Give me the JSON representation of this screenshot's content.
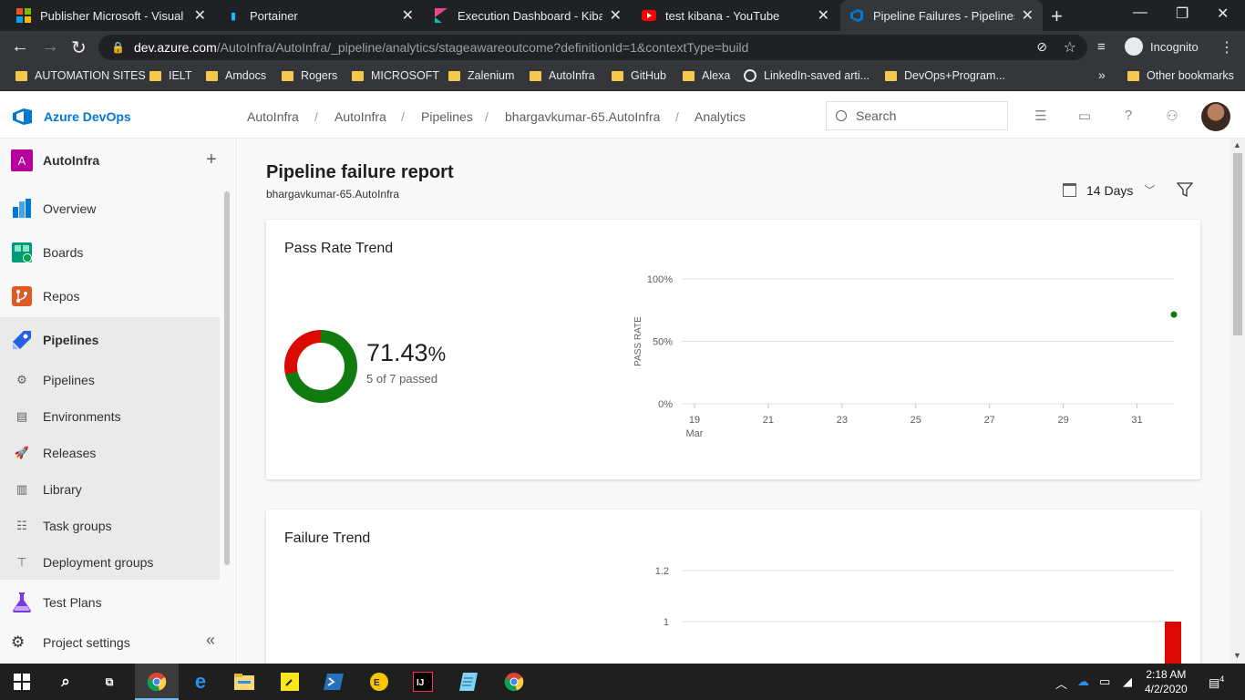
{
  "browser": {
    "tabs": [
      {
        "title": "Publisher Microsoft - Visual Stu",
        "icon": "windows-icon",
        "color": "#f25022"
      },
      {
        "title": "Portainer",
        "icon": "portainer-icon",
        "color": "#13bef9"
      },
      {
        "title": "Execution Dashboard - Kibana",
        "icon": "kibana-icon",
        "color": "#e8488b"
      },
      {
        "title": "test kibana - YouTube",
        "icon": "youtube-icon",
        "color": "#ff0000"
      },
      {
        "title": "Pipeline Failures - Pipelines",
        "icon": "azure-devops-icon",
        "color": "#0078d4",
        "active": true
      }
    ],
    "url_host": "dev.azure.com",
    "url_path": "/AutoInfra/AutoInfra/_pipeline/analytics/stageawareoutcome?definitionId=1&contextType=build",
    "incognito_label": "Incognito",
    "bookmarks": [
      {
        "label": "AUTOMATION SITES",
        "icon": "folder-icon"
      },
      {
        "label": "IELT",
        "icon": "folder-icon"
      },
      {
        "label": "Amdocs",
        "icon": "folder-icon"
      },
      {
        "label": "Rogers",
        "icon": "folder-icon"
      },
      {
        "label": "MICROSOFT",
        "icon": "folder-icon"
      },
      {
        "label": "Zalenium",
        "icon": "folder-icon"
      },
      {
        "label": "AutoInfra",
        "icon": "folder-icon"
      },
      {
        "label": "GitHub",
        "icon": "folder-icon"
      },
      {
        "label": "Alexa",
        "icon": "folder-icon"
      },
      {
        "label": "LinkedIn-saved arti...",
        "icon": "globe-icon"
      },
      {
        "label": "DevOps+Program...",
        "icon": "folder-icon"
      }
    ],
    "bookmarks_overflow": "»",
    "other_bookmarks": "Other bookmarks"
  },
  "ado": {
    "brand": "Azure DevOps",
    "breadcrumb": [
      "AutoInfra",
      "AutoInfra",
      "Pipelines",
      "bhargavkumar-65.AutoInfra",
      "Analytics"
    ],
    "breadcrumb_sep": "/",
    "search_placeholder": "Search"
  },
  "sidebar": {
    "project_initial": "A",
    "project_name": "AutoInfra",
    "add_symbol": "+",
    "items": [
      {
        "label": "Overview",
        "icon": "overview-icon",
        "color": "#0078d4"
      },
      {
        "label": "Boards",
        "icon": "boards-icon",
        "color": "#009b77"
      },
      {
        "label": "Repos",
        "icon": "repos-icon",
        "color": "#e05a27"
      },
      {
        "label": "Pipelines",
        "icon": "pipelines-icon",
        "color": "#2560e0",
        "selected": true
      },
      {
        "label": "Test Plans",
        "icon": "test-plans-icon",
        "color": "#773adc"
      },
      {
        "label": "Project settings",
        "icon": "gear-icon",
        "color": "#605e5c"
      }
    ],
    "sub_items": [
      {
        "label": "Pipelines",
        "icon": "pipelines-sub-icon"
      },
      {
        "label": "Environments",
        "icon": "environments-icon"
      },
      {
        "label": "Releases",
        "icon": "releases-icon"
      },
      {
        "label": "Library",
        "icon": "library-icon"
      },
      {
        "label": "Task groups",
        "icon": "task-groups-icon"
      },
      {
        "label": "Deployment groups",
        "icon": "deployment-groups-icon"
      }
    ],
    "collapse_symbol": "«"
  },
  "report": {
    "title": "Pipeline failure report",
    "subtitle": "bhargavkumar-65.AutoInfra",
    "range_label": "14 Days",
    "pass_card_title": "Pass Rate Trend",
    "pass_rate_value": "71.43",
    "pass_rate_unit": "%",
    "pass_count_text": "5 of 7 passed",
    "failure_card_title": "Failure Trend",
    "colors": {
      "pass": "#107c10",
      "fail": "#da0a00",
      "accent": "#0078d4"
    }
  },
  "chart_data": [
    {
      "type": "pie",
      "title": "",
      "slices": [
        {
          "label": "passed",
          "value": 5,
          "color": "#107c10"
        },
        {
          "label": "failed",
          "value": 2,
          "color": "#da0a00"
        }
      ]
    },
    {
      "type": "scatter",
      "title": "",
      "ylabel": "PASS RATE",
      "y_ticks": [
        "100%",
        "50%",
        "0%"
      ],
      "ylim": [
        0,
        100
      ],
      "x_ticks": [
        "19",
        "21",
        "23",
        "25",
        "27",
        "29",
        "31"
      ],
      "x_sublabel": "Mar",
      "x_domain": [
        19,
        32
      ],
      "series": [
        {
          "values": [
            {
              "x": 32,
              "y": 71.43
            }
          ],
          "color": "#107c10"
        }
      ],
      "grid": true
    },
    {
      "type": "bar",
      "title": "",
      "y_ticks": [
        "1.2",
        "1"
      ],
      "ylim": [
        0,
        1.2
      ],
      "x_domain": [
        19,
        32
      ],
      "series": [
        {
          "values": [
            {
              "x": 32,
              "y": 1
            }
          ],
          "color": "#da0a00"
        }
      ],
      "grid": true
    }
  ],
  "taskbar": {
    "time": "2:18 AM",
    "date": "4/2/2020",
    "notification_count": "4"
  }
}
